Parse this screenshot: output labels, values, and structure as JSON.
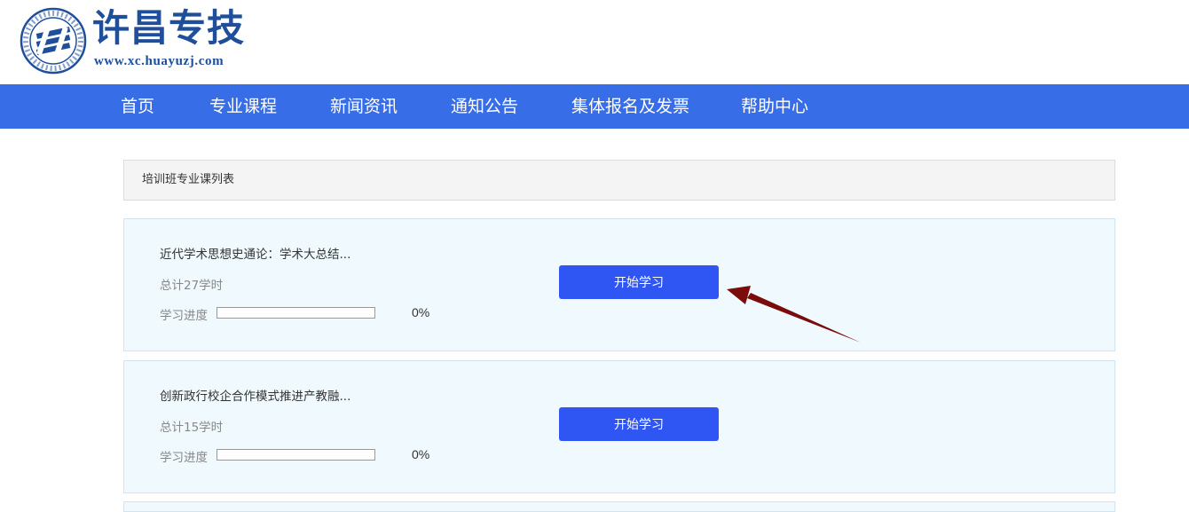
{
  "header": {
    "logo_title": "许昌专技",
    "logo_url": "www.xc.huayuzj.com"
  },
  "nav": {
    "items": [
      {
        "label": "首页"
      },
      {
        "label": "专业课程"
      },
      {
        "label": "新闻资讯"
      },
      {
        "label": "通知公告"
      },
      {
        "label": "集体报名及发票"
      },
      {
        "label": "帮助中心"
      }
    ]
  },
  "section": {
    "title": "培训班专业课列表"
  },
  "courses": [
    {
      "title": "近代学术思想史通论：学术大总结...",
      "hours": "总计27学时",
      "progress_label": "学习进度",
      "progress_value": 0,
      "progress_text": "0%",
      "button_label": "开始学习"
    },
    {
      "title": "创新政行校企合作模式推进产教融...",
      "hours": "总计15学时",
      "progress_label": "学习进度",
      "progress_value": 0,
      "progress_text": "0%",
      "button_label": "开始学习"
    }
  ],
  "colors": {
    "brand": "#1f4e9a",
    "nav_bg": "#386de8",
    "button_bg": "#2f55f3",
    "card_bg": "#f0f9fd",
    "annotation_arrow": "#7a0c0c"
  }
}
